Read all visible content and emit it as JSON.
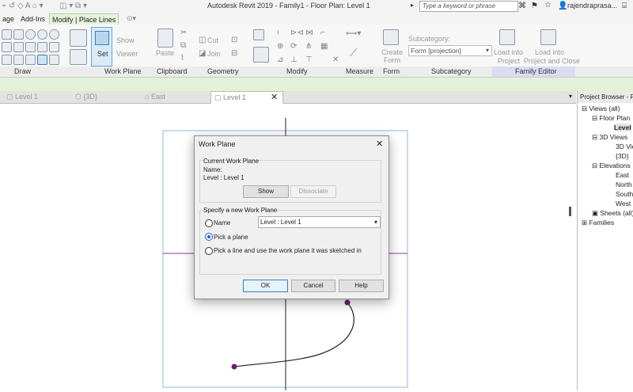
{
  "window": {
    "title": "Autodesk Revit 2019 - Family1 - Floor Plan: Level 1",
    "search_placeholder": "Type a keyword or phrase",
    "user": "rajendraprasa..."
  },
  "tabs": [
    "age",
    "Add-Ins",
    "Modify | Place Lines"
  ],
  "ribbon": {
    "draw_label": "Draw",
    "workplane_label": "Work Plane",
    "clipboard_label": "Clipboard",
    "geometry_label": "Geometry",
    "modify_label": "Modify",
    "measure_label": "Measure",
    "form_label": "Form",
    "subcategory_label": "Subcategory",
    "family_editor_label": "Family Editor",
    "set": "Set",
    "show": "Show",
    "viewer": "Viewer",
    "paste": "Paste",
    "cut": "Cut",
    "join": "Join",
    "create_form_1": "Create",
    "create_form_2": "Form",
    "subcategory_caption": "Subcategory:",
    "subcategory_value": "Form [projection]",
    "load_into_project_1": "Load into",
    "load_into_project_2": "Project",
    "load_close_1": "Load into",
    "load_close_2": "Project and Close"
  },
  "view_tabs": [
    "Level 1",
    "{3D}",
    "East",
    "Level 1"
  ],
  "browser": {
    "header": "Project Browser - F",
    "items": [
      "Views (all)",
      "Floor Plan",
      "Level",
      "3D Views",
      "3D Vie",
      "{3D}",
      "Elevations",
      "East",
      "North",
      "South",
      "West",
      "Sheets (all)",
      "Families"
    ]
  },
  "dialog": {
    "title": "Work Plane",
    "current_group": "Current Work Plane",
    "name_caption": "Name:",
    "name_value": "Level : Level 1",
    "show_btn": "Show",
    "dissociate_btn": "Dissociate",
    "specify_group": "Specify a new Work Plane",
    "opt_name": "Name",
    "opt_name_value": "Level : Level 1",
    "opt_pick_plane": "Pick a plane",
    "opt_pick_line": "Pick a line and use the work plane it was sketched in",
    "selected_option": "Pick a plane",
    "ok": "OK",
    "cancel": "Cancel",
    "help": "Help"
  },
  "colors": {
    "active_tab": "#e7f3dd",
    "accent": "#1a63b8",
    "sketch_point": "#6b1e6e",
    "ref_plane": "#8e3b8e"
  }
}
